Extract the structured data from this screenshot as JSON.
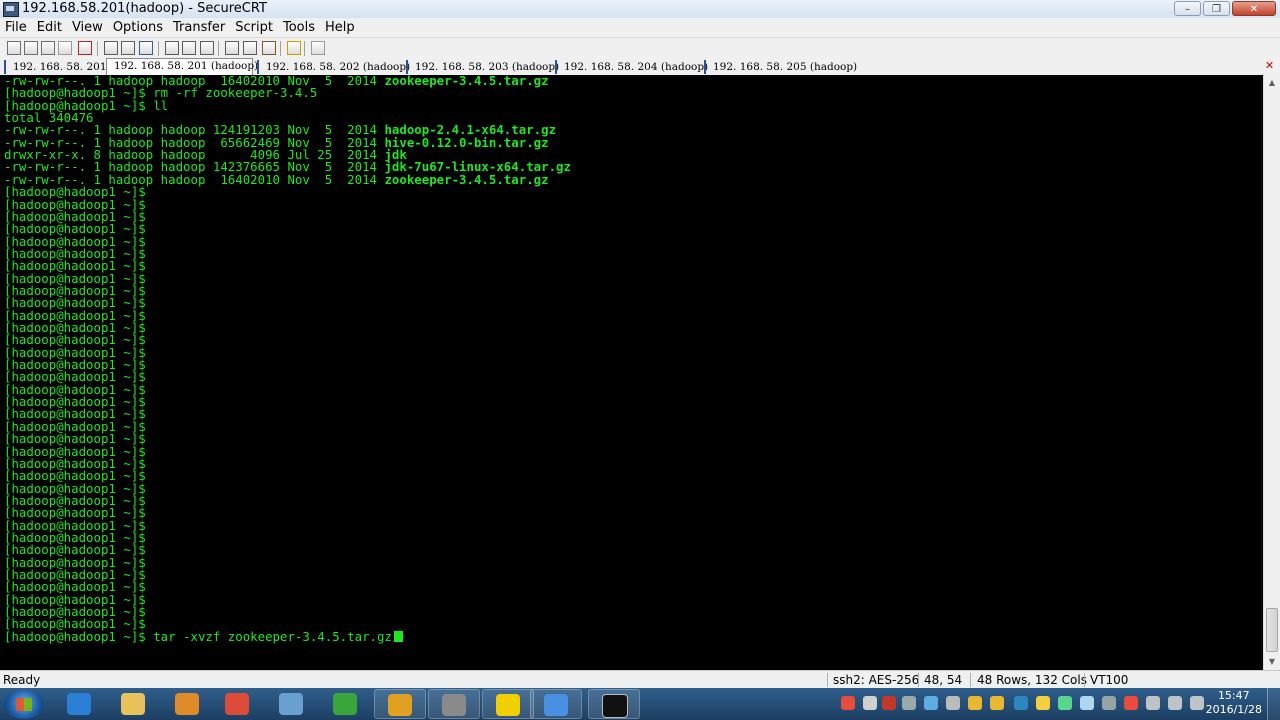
{
  "window": {
    "title": "192.168.58.201(hadoop) - SecureCRT"
  },
  "menu": [
    "File",
    "Edit",
    "View",
    "Options",
    "Transfer",
    "Script",
    "Tools",
    "Help"
  ],
  "tabs": [
    {
      "label": "192. 168. 58. 201"
    },
    {
      "label": "192. 168. 58. 201 (hadoop)"
    },
    {
      "label": "192. 168. 58. 202 (hadoop)"
    },
    {
      "label": "192. 168. 58. 203 (hadoop)"
    },
    {
      "label": "192. 168. 58. 204 (hadoop)"
    },
    {
      "label": "192. 168. 58. 205 (hadoop)"
    }
  ],
  "terminal": {
    "lines": [
      {
        "text": "-rw-rw-r--. 1 hadoop hadoop  16402010 Nov  5  2014 ",
        "file": "zookeeper-3.4.5.tar.gz"
      },
      {
        "text": "[hadoop@hadoop1 ~]$ rm -rf zookeeper-3.4.5",
        "file": ""
      },
      {
        "text": "[hadoop@hadoop1 ~]$ ll",
        "file": ""
      },
      {
        "text": "total 340476",
        "file": ""
      },
      {
        "text": "-rw-rw-r--. 1 hadoop hadoop 124191203 Nov  5  2014 ",
        "file": "hadoop-2.4.1-x64.tar.gz"
      },
      {
        "text": "-rw-rw-r--. 1 hadoop hadoop  65662469 Nov  5  2014 ",
        "file": "hive-0.12.0-bin.tar.gz"
      },
      {
        "text": "drwxr-xr-x. 8 hadoop hadoop      4096 Jul 25  2014 ",
        "file": "jdk"
      },
      {
        "text": "-rw-rw-r--. 1 hadoop hadoop 142376665 Nov  5  2014 ",
        "file": "jdk-7u67-linux-x64.tar.gz"
      },
      {
        "text": "-rw-rw-r--. 1 hadoop hadoop  16402010 Nov  5  2014 ",
        "file": "zookeeper-3.4.5.tar.gz"
      },
      {
        "text": "[hadoop@hadoop1 ~]$",
        "file": ""
      },
      {
        "text": "[hadoop@hadoop1 ~]$",
        "file": ""
      },
      {
        "text": "[hadoop@hadoop1 ~]$",
        "file": ""
      },
      {
        "text": "[hadoop@hadoop1 ~]$",
        "file": ""
      },
      {
        "text": "[hadoop@hadoop1 ~]$",
        "file": ""
      },
      {
        "text": "[hadoop@hadoop1 ~]$",
        "file": ""
      },
      {
        "text": "[hadoop@hadoop1 ~]$",
        "file": ""
      },
      {
        "text": "[hadoop@hadoop1 ~]$",
        "file": ""
      },
      {
        "text": "[hadoop@hadoop1 ~]$",
        "file": ""
      },
      {
        "text": "[hadoop@hadoop1 ~]$",
        "file": ""
      },
      {
        "text": "[hadoop@hadoop1 ~]$",
        "file": ""
      },
      {
        "text": "[hadoop@hadoop1 ~]$",
        "file": ""
      },
      {
        "text": "[hadoop@hadoop1 ~]$",
        "file": ""
      },
      {
        "text": "[hadoop@hadoop1 ~]$",
        "file": ""
      },
      {
        "text": "[hadoop@hadoop1 ~]$",
        "file": ""
      },
      {
        "text": "[hadoop@hadoop1 ~]$",
        "file": ""
      },
      {
        "text": "[hadoop@hadoop1 ~]$",
        "file": ""
      },
      {
        "text": "[hadoop@hadoop1 ~]$",
        "file": ""
      },
      {
        "text": "[hadoop@hadoop1 ~]$",
        "file": ""
      },
      {
        "text": "[hadoop@hadoop1 ~]$",
        "file": ""
      },
      {
        "text": "[hadoop@hadoop1 ~]$",
        "file": ""
      },
      {
        "text": "[hadoop@hadoop1 ~]$",
        "file": ""
      },
      {
        "text": "[hadoop@hadoop1 ~]$",
        "file": ""
      },
      {
        "text": "[hadoop@hadoop1 ~]$",
        "file": ""
      },
      {
        "text": "[hadoop@hadoop1 ~]$",
        "file": ""
      },
      {
        "text": "[hadoop@hadoop1 ~]$",
        "file": ""
      },
      {
        "text": "[hadoop@hadoop1 ~]$",
        "file": ""
      },
      {
        "text": "[hadoop@hadoop1 ~]$",
        "file": ""
      },
      {
        "text": "[hadoop@hadoop1 ~]$",
        "file": ""
      },
      {
        "text": "[hadoop@hadoop1 ~]$",
        "file": ""
      },
      {
        "text": "[hadoop@hadoop1 ~]$",
        "file": ""
      },
      {
        "text": "[hadoop@hadoop1 ~]$",
        "file": ""
      },
      {
        "text": "[hadoop@hadoop1 ~]$",
        "file": ""
      },
      {
        "text": "[hadoop@hadoop1 ~]$",
        "file": ""
      },
      {
        "text": "[hadoop@hadoop1 ~]$",
        "file": ""
      },
      {
        "text": "[hadoop@hadoop1 ~]$",
        "file": ""
      },
      {
        "text": "[hadoop@hadoop1 ~]$ tar -xvzf zookeeper-3.4.5.tar.gz",
        "file": ""
      }
    ],
    "colors": {
      "background": "#000000",
      "foreground": "#1ee81e"
    }
  },
  "statusbar": {
    "state": "Ready",
    "cipher": "ssh2: AES-256",
    "cursor_pos": "48,  54",
    "size": "48 Rows, 132 Cols",
    "emulation": "VT100"
  },
  "taskbar": {
    "apps": [
      "internet-explorer-icon",
      "file-explorer-icon",
      "media-player-icon",
      "chrome-icon",
      "tool-icon",
      "refresh-icon",
      "e-icon",
      "tool-icon",
      "music-icon",
      "folder-icon",
      "terminal-icon"
    ],
    "time": "15:47",
    "date": "2016/1/28"
  }
}
